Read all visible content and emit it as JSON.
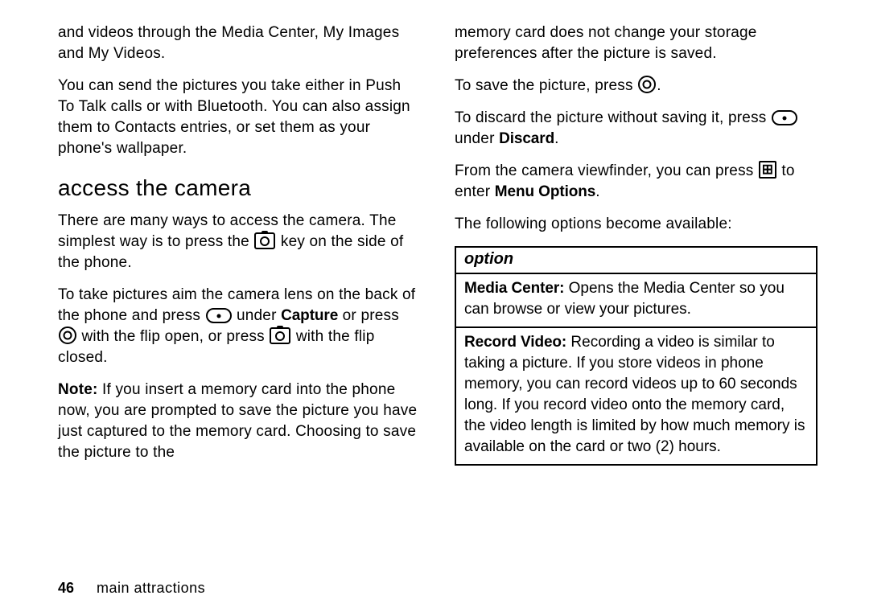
{
  "left": {
    "p1": "and videos through the Media Center, My Images and My Videos.",
    "p2": "You can send the pictures you take either in Push To Talk calls or with Bluetooth. You can also assign them to Contacts entries, or set them as your phone's wallpaper.",
    "heading": "access the camera",
    "p3a": "There are many ways to access the camera. The simplest way is to press the ",
    "p3b": " key on the side of the phone.",
    "p4a": "To take pictures aim the camera lens on the back of the phone and press ",
    "p4b": " under ",
    "p4c": "Capture",
    "p4d": " or press ",
    "p4e": " with the flip open, or press ",
    "p4f": " with the flip closed.",
    "noteLabel": "Note:",
    "note": " If you insert a memory card into the phone now, you are prompted to save the picture you have just captured to the memory card. Choosing to save the picture to the "
  },
  "right": {
    "p1": "memory card does not change your storage preferences after the picture is saved.",
    "p2a": "To save the picture, press ",
    "p2b": ".",
    "p3a": "To discard the picture without saving it, press ",
    "p3b": " under ",
    "p3c": "Discard",
    "p3d": ".",
    "p4a": "From the camera viewfinder, you can press ",
    "p4b": " to enter ",
    "p4c": "Menu Options",
    "p4d": ".",
    "p5": "The following options become available:",
    "table": {
      "header": "option",
      "row1Label": "Media Center:",
      "row1Text": " Opens the Media Center so you can browse or view your pictures.",
      "row2Label": "Record Video:",
      "row2Text": " Recording a video is similar to taking a picture. If you store videos in phone memory, you can record videos up to 60 seconds long. If you record video onto the memory card, the video length is limited by how much memory is available on the card or two (2) hours."
    }
  },
  "footer": {
    "page": "46",
    "section": "main attractions"
  }
}
